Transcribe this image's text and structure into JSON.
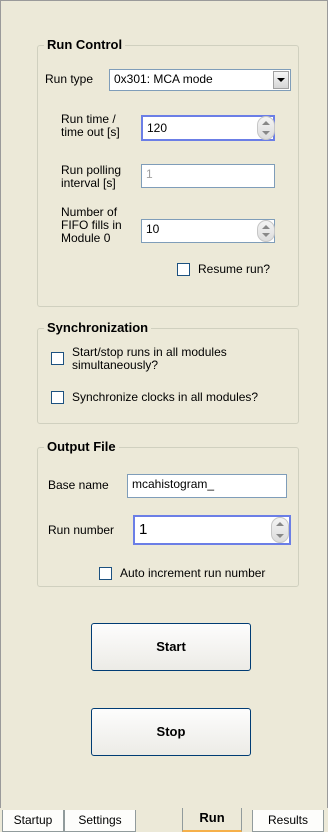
{
  "run_control": {
    "title": "Run Control",
    "run_type_label": "Run type",
    "run_type_value": "0x301: MCA mode",
    "run_time_label_1": "Run time /",
    "run_time_label_2": "time out [s]",
    "run_time_value": "120",
    "polling_label_1": "Run polling",
    "polling_label_2": "interval [s]",
    "polling_value": "1",
    "fifo_label_1": "Number of",
    "fifo_label_2": "FIFO fills in",
    "fifo_label_3": "Module 0",
    "fifo_value": "10",
    "resume_label": "Resume run?"
  },
  "synchronization": {
    "title": "Synchronization",
    "start_stop_label_1": "Start/stop runs in all modules",
    "start_stop_label_2": "simultaneously?",
    "sync_clocks_label": "Synchronize clocks in all modules?"
  },
  "output_file": {
    "title": "Output File",
    "base_name_label": "Base name",
    "base_name_value": "mcahistogram_",
    "run_number_label": "Run number",
    "run_number_value": "1",
    "auto_increment_label": "Auto increment run number"
  },
  "buttons": {
    "start": "Start",
    "stop": "Stop"
  },
  "tabs": [
    "Startup",
    "Settings",
    "Run",
    "Results"
  ]
}
